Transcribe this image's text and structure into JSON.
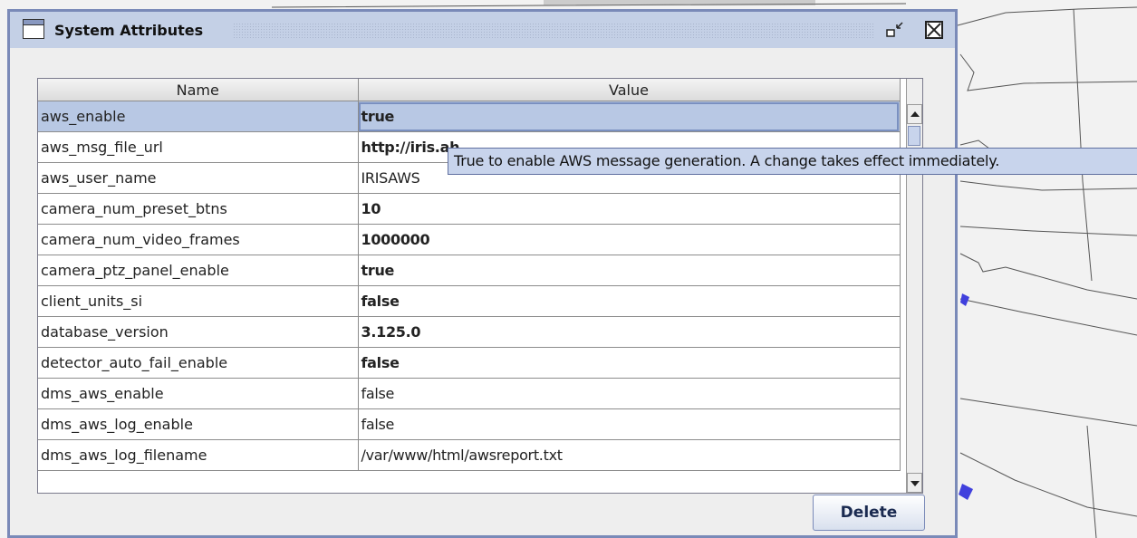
{
  "window": {
    "title": "System Attributes"
  },
  "table": {
    "headers": {
      "name": "Name",
      "value": "Value"
    },
    "rows": [
      {
        "name": "aws_enable",
        "value": "true",
        "bold": true,
        "selected": true
      },
      {
        "name": "aws_msg_file_url",
        "value": "http://iris.ah...",
        "bold": true,
        "selected": false
      },
      {
        "name": "aws_user_name",
        "value": "IRISAWS",
        "bold": false,
        "selected": false
      },
      {
        "name": "camera_num_preset_btns",
        "value": "10",
        "bold": true,
        "selected": false
      },
      {
        "name": "camera_num_video_frames",
        "value": "1000000",
        "bold": true,
        "selected": false
      },
      {
        "name": "camera_ptz_panel_enable",
        "value": "true",
        "bold": true,
        "selected": false
      },
      {
        "name": "client_units_si",
        "value": "false",
        "bold": true,
        "selected": false
      },
      {
        "name": "database_version",
        "value": "3.125.0",
        "bold": true,
        "selected": false
      },
      {
        "name": "detector_auto_fail_enable",
        "value": "false",
        "bold": true,
        "selected": false
      },
      {
        "name": "dms_aws_enable",
        "value": "false",
        "bold": false,
        "selected": false
      },
      {
        "name": "dms_aws_log_enable",
        "value": "false",
        "bold": false,
        "selected": false
      },
      {
        "name": "dms_aws_log_filename",
        "value": "/var/www/html/awsreport.txt",
        "bold": false,
        "selected": false
      }
    ]
  },
  "tooltip": {
    "text": "True to enable AWS message generation. A change takes effect immediately."
  },
  "buttons": {
    "delete_label": "Delete"
  },
  "colors": {
    "titlebar": "#c4d0e6",
    "selection": "#b8c8e4",
    "window_border": "#7a8ab8"
  }
}
